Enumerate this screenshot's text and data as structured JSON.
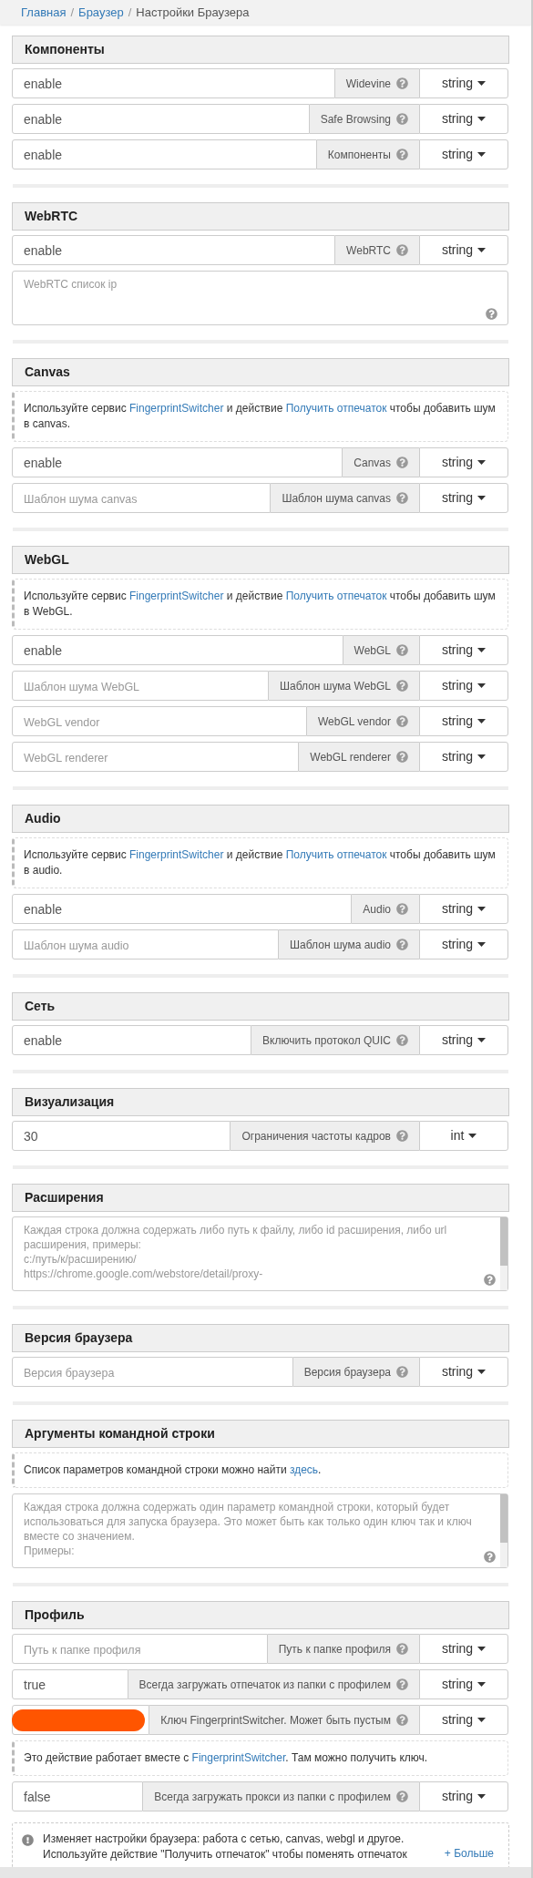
{
  "breadcrumb_separator": "/",
  "breadcrumb": [
    {
      "label": "Главная",
      "link": true
    },
    {
      "label": "Браузер",
      "link": true
    },
    {
      "label": "Настройки Браузера",
      "link": false
    }
  ],
  "sections": [
    {
      "title": "Компоненты",
      "items": [
        {
          "kind": "field",
          "value": "enable",
          "label": "Widevine",
          "type": "string"
        },
        {
          "kind": "field",
          "value": "enable",
          "label": "Safe Browsing",
          "type": "string"
        },
        {
          "kind": "field",
          "value": "enable",
          "label": "Компоненты",
          "type": "string"
        }
      ]
    },
    {
      "title": "WebRTC",
      "items": [
        {
          "kind": "field",
          "value": "enable",
          "label": "WebRTC",
          "type": "string"
        },
        {
          "kind": "textarea",
          "placeholder": "WebRTC список ip"
        }
      ]
    },
    {
      "title": "Canvas",
      "items": [
        {
          "kind": "note",
          "parts": [
            {
              "text": "Используйте сервис ",
              "link": false
            },
            {
              "text": "FingerprintSwitcher",
              "link": true
            },
            {
              "text": " и действие ",
              "link": false
            },
            {
              "text": "Получить отпечаток",
              "link": true
            },
            {
              "text": " чтобы добавить шум в canvas.",
              "link": false
            }
          ]
        },
        {
          "kind": "field",
          "value": "enable",
          "label": "Canvas",
          "type": "string"
        },
        {
          "kind": "field",
          "placeholder": "Шаблон шума canvas",
          "label": "Шаблон шума canvas",
          "type": "string"
        }
      ]
    },
    {
      "title": "WebGL",
      "items": [
        {
          "kind": "note",
          "parts": [
            {
              "text": "Используйте сервис ",
              "link": false
            },
            {
              "text": "FingerprintSwitcher",
              "link": true
            },
            {
              "text": " и действие ",
              "link": false
            },
            {
              "text": "Получить отпечаток",
              "link": true
            },
            {
              "text": " чтобы добавить шум в WebGL.",
              "link": false
            }
          ]
        },
        {
          "kind": "field",
          "value": "enable",
          "label": "WebGL",
          "type": "string"
        },
        {
          "kind": "field",
          "placeholder": "Шаблон шума WebGL",
          "label": "Шаблон шума WebGL",
          "type": "string"
        },
        {
          "kind": "field",
          "placeholder": "WebGL vendor",
          "label": "WebGL vendor",
          "type": "string"
        },
        {
          "kind": "field",
          "placeholder": "WebGL renderer",
          "label": "WebGL renderer",
          "type": "string"
        }
      ]
    },
    {
      "title": "Audio",
      "items": [
        {
          "kind": "note",
          "parts": [
            {
              "text": "Используйте сервис ",
              "link": false
            },
            {
              "text": "FingerprintSwitcher",
              "link": true
            },
            {
              "text": " и действие ",
              "link": false
            },
            {
              "text": "Получить отпечаток",
              "link": true
            },
            {
              "text": " чтобы добавить шум в audio.",
              "link": false
            }
          ]
        },
        {
          "kind": "field",
          "value": "enable",
          "label": "Audio",
          "type": "string"
        },
        {
          "kind": "field",
          "placeholder": "Шаблон шума audio",
          "label": "Шаблон шума audio",
          "type": "string"
        }
      ]
    },
    {
      "title": "Сеть",
      "items": [
        {
          "kind": "field",
          "value": "enable",
          "label": "Включить протокол QUIC",
          "type": "string"
        }
      ]
    },
    {
      "title": "Визуализация",
      "items": [
        {
          "kind": "field",
          "value": "30",
          "label": "Ограничения частоты кадров",
          "type": "int"
        }
      ]
    },
    {
      "title": "Расширения",
      "items": [
        {
          "kind": "textarea",
          "placeholder": "Каждая строка должна содержать либо путь к файлу, либо id расширения, либо url расширения, примеры:\nc:/путь/к/расширению/\nhttps://chrome.google.com/webstore/detail/proxy-",
          "scroll": true
        }
      ]
    },
    {
      "title": "Версия браузера",
      "items": [
        {
          "kind": "field",
          "placeholder": "Версия браузера",
          "label": "Версия браузера",
          "type": "string"
        }
      ]
    },
    {
      "title": "Аргументы командной строки",
      "items": [
        {
          "kind": "note",
          "parts": [
            {
              "text": "Список параметров командной строки можно найти ",
              "link": false
            },
            {
              "text": "здесь",
              "link": true
            },
            {
              "text": ".",
              "link": false
            }
          ]
        },
        {
          "kind": "textarea",
          "placeholder": "Каждая строка должна содержать один параметр командной строки, который будет использоваться для запуска браузера. Это может быть как только один ключ так и ключ вместе со значением.\nПримеры:",
          "scroll": true
        }
      ]
    },
    {
      "title": "Профиль",
      "items": [
        {
          "kind": "field",
          "placeholder": "Путь к папке профиля",
          "label": "Путь к папке профиля",
          "type": "string"
        },
        {
          "kind": "field",
          "value": "true",
          "label": "Всегда загружать отпечаток из папки с профилем",
          "type": "string"
        },
        {
          "kind": "field",
          "redacted": true,
          "label": "Ключ FingerprintSwitcher. Может быть пустым",
          "type": "string"
        },
        {
          "kind": "note",
          "parts": [
            {
              "text": "Это действие работает вместе с ",
              "link": false
            },
            {
              "text": "FingerprintSwitcher",
              "link": true
            },
            {
              "text": ". Там можно получить ключ.",
              "link": false
            }
          ]
        },
        {
          "kind": "field",
          "value": "false",
          "label": "Всегда загружать прокси из папки с профилем",
          "type": "string"
        }
      ]
    }
  ],
  "footer_note": {
    "lines": [
      "Изменяет настройки браузера: работа с сетью, canvas, webgl и другое.",
      "Используйте действие \"Получить отпечаток\" чтобы поменять отпечаток"
    ],
    "more": "+ Больше"
  }
}
